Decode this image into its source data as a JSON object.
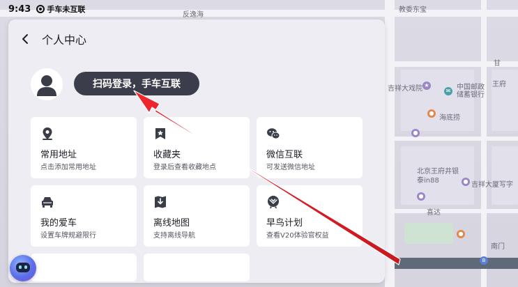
{
  "status_bar": {
    "time": "9:43",
    "app_name": "手车未互联"
  },
  "map": {
    "labels": [
      "反逸海",
      "教委东宝",
      "甘",
      "中国邮政储蓄银行",
      "吉祥大戏院",
      "王府",
      "海底捞",
      "北京王府井银泰in88",
      "吉祥大厦写字",
      "喜达",
      "南门"
    ]
  },
  "panel": {
    "title": "个人中心",
    "login_button": "扫码登录，手车互联",
    "cards": [
      {
        "title": "常用地址",
        "subtitle": "点击添加常用地址",
        "icon": "location-pin-icon"
      },
      {
        "title": "收藏夹",
        "subtitle": "登录后查看收藏地点",
        "icon": "bookmark-star-icon"
      },
      {
        "title": "微信互联",
        "subtitle": "可发送微信地址",
        "icon": "wechat-icon"
      },
      {
        "title": "我的爱车",
        "subtitle": "设置车牌规避限行",
        "icon": "car-icon"
      },
      {
        "title": "离线地图",
        "subtitle": "支持离线导航",
        "icon": "download-map-icon"
      },
      {
        "title": "早鸟计划",
        "subtitle": "查看V20体验官权益",
        "icon": "early-bird-badge-icon"
      }
    ]
  },
  "colors": {
    "panel_bg": "#eeedf4",
    "login_button_bg": "#3b3e4a",
    "card_bg": "#ffffff",
    "annotation_arrow": "#e8202a"
  }
}
